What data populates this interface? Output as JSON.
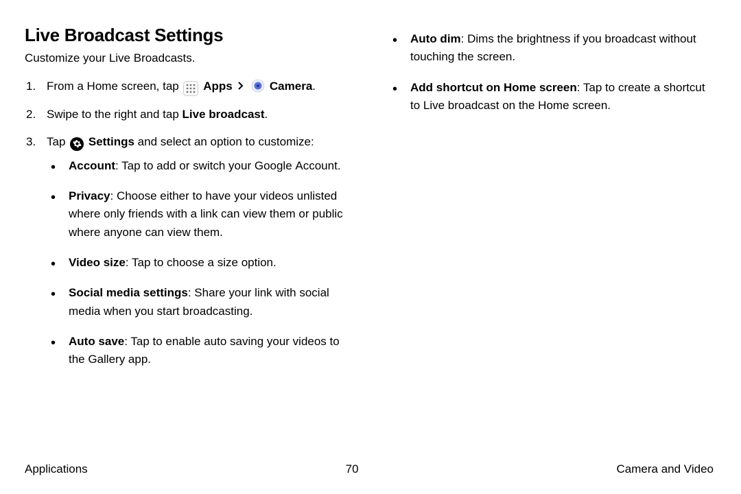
{
  "title": "Live Broadcast Settings",
  "subtitle": "Customize your Live Broadcasts.",
  "step1_a": "From a Home screen, tap ",
  "step1_apps": "Apps",
  "step1_camera": "Camera",
  "step1_end": ".",
  "step2_a": "Swipe to the right and tap ",
  "step2_b": "Live broadcast",
  "step2_c": ".",
  "step3_a": "Tap ",
  "step3_b": "Settings",
  "step3_c": " and select an option to customize:",
  "bullets_left": [
    {
      "label": "Account",
      "text": ": Tap to add or switch your Google Account."
    },
    {
      "label": "Privacy",
      "text": ": Choose either to have your videos unlisted where only friends with a link can view them or public where anyone can view them."
    },
    {
      "label": "Video size",
      "text": ": Tap to choose a size option."
    },
    {
      "label": "Social media settings",
      "text": ": Share your link with social media when you start broadcasting."
    },
    {
      "label": "Auto save",
      "text": ": Tap to enable auto saving your videos to the Gallery app."
    }
  ],
  "bullets_right": [
    {
      "label": "Auto dim",
      "text": ": Dims the brightness if you broadcast without touching the screen."
    },
    {
      "label": "Add shortcut on Home screen",
      "text": ": Tap to create a shortcut to Live broadcast on the Home screen."
    }
  ],
  "footer": {
    "left": "Applications",
    "center": "70",
    "right": "Camera and Video"
  }
}
